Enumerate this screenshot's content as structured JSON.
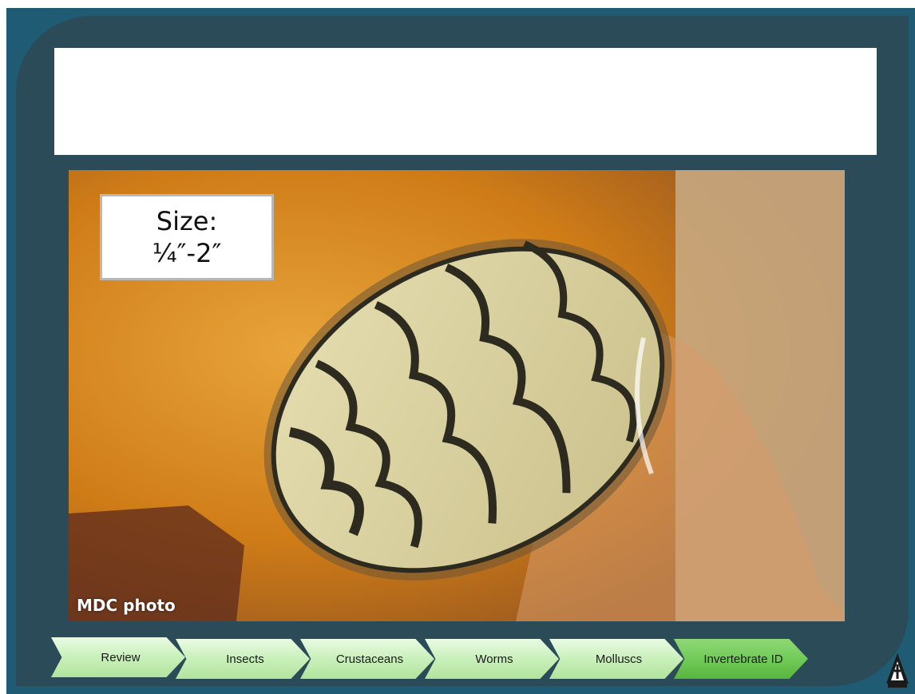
{
  "slide": {
    "title": "",
    "size_label_line1": "Size:",
    "size_label_line2": "¼″-2″",
    "photo_credit": "MDC photo"
  },
  "nav": {
    "items": [
      {
        "label": "Review",
        "active": false
      },
      {
        "label": "Insects",
        "active": false
      },
      {
        "label": "Crustaceans",
        "active": false
      },
      {
        "label": "Worms",
        "active": false
      },
      {
        "label": "Molluscs",
        "active": false
      },
      {
        "label": "Invertebrate ID",
        "active": true
      }
    ]
  },
  "colors": {
    "frame": "#1f5b73",
    "panel": "#2c4b58",
    "nav_inactive": "#c9f0bb",
    "nav_active": "#6fc955"
  },
  "icons": {
    "logo": "conservation-logo-icon"
  }
}
